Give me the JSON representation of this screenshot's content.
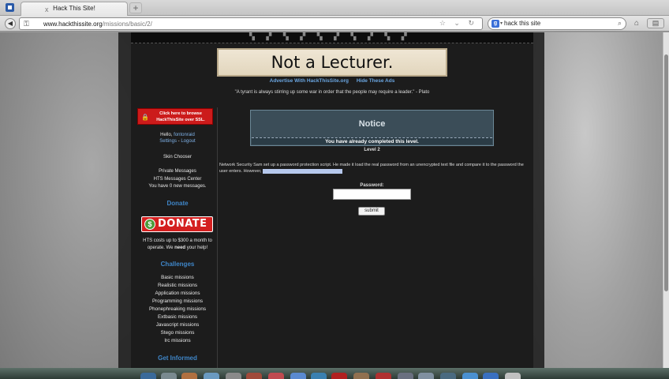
{
  "browser": {
    "tab_title": "Hack This Site!",
    "tab_close": "x",
    "new_tab": "+",
    "url_domain": "www.hackthissite.org",
    "url_path": "/missions/basic/2/",
    "url_icons": "☆ ⌄ ↻",
    "search_engine": "g",
    "search_value": "hack this site",
    "icons": {
      "back": "back-arrow-icon",
      "key": "key-icon",
      "home": "home-icon",
      "bookmarks": "bookmarks-icon"
    }
  },
  "site": {
    "banner": "Not a Lecturer.",
    "ad_links": [
      "Advertise With HackThisSite.org",
      "Hide These Ads"
    ],
    "quote": "\"A tyrant is always stirring up some war in order that the people may require a leader.\" - Plato",
    "sidebar": {
      "ssl_button": "Click here to browse HackThisSite over SSL.",
      "greeting": "Hello,",
      "username": "fontonraid",
      "settings": "Settings",
      "logout": "Logout",
      "separator": " - ",
      "skin_chooser": "Skin Chooser",
      "private_messages": "Private Messages",
      "messages_center": "HTS Messages Center",
      "new_messages": "You have 0 new messages.",
      "donate_heading": "Donate",
      "donate_button": "DONATE",
      "donate_note_1": "HTS costs up to $300 a month to",
      "donate_note_2_pre": "operate. We ",
      "donate_note_2_bold": "need",
      "donate_note_2_post": " your help!",
      "challenges_heading": "Challenges",
      "missions": [
        "Basic missions",
        "Realistic missions",
        "Application missions",
        "Programming missions",
        "Phonephreaking missions",
        "Extbasic missions",
        "Javascript missions",
        "Stego missions",
        "Irc missions"
      ],
      "get_informed_heading": "Get Informed"
    },
    "main": {
      "notice_title": "Notice",
      "notice_message": "You have already completed this level.",
      "level_label": "Level 2",
      "mission_description": "Network Security Sam set up a password protection script. He made it load the real password from an unencrypted text file and compare it to the password the user enters. However,",
      "hidden_text": "he neglected to upload the password file",
      "password_label": "Password:",
      "password_value": "",
      "submit_label": "submit"
    }
  }
}
